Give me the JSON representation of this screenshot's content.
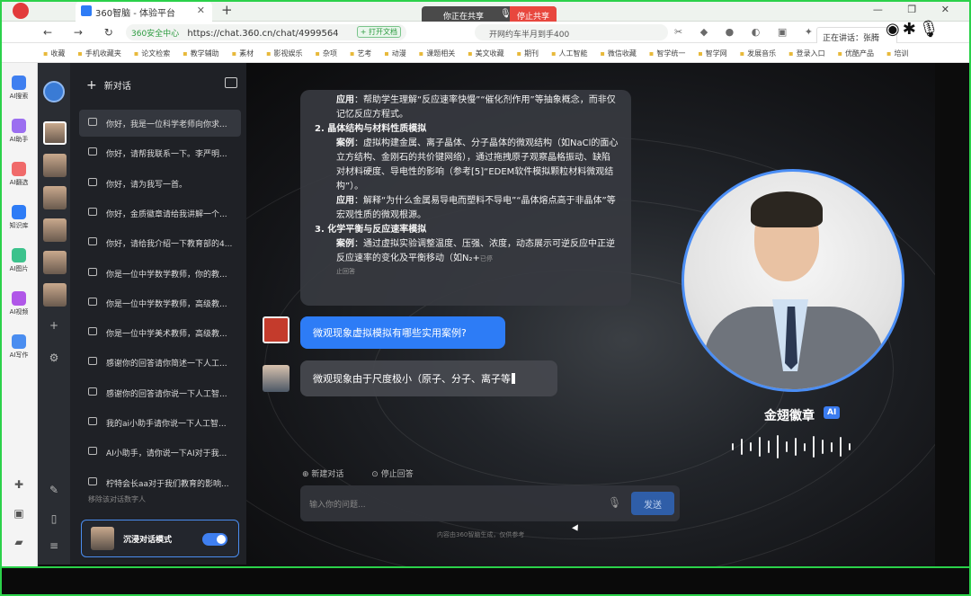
{
  "browser": {
    "tab_title": "360智脑 - 体验平台",
    "share_text": "你正在共享",
    "stop_share": "停止共享",
    "url_secure": "360安全中心",
    "url": "https://chat.360.cn/chat/4999564",
    "open_doc": "+ 打开文档",
    "search": "开网约车半月到手400",
    "speaking": "正在讲话：张腾",
    "bookmarks": [
      "收藏",
      "手机收藏夹",
      "论文检索",
      "教学辅助",
      "素材",
      "影视娱乐",
      "杂项",
      "艺考",
      "动漫",
      "课题相关",
      "美文收藏",
      "期刊",
      "人工智能",
      "微信收藏",
      "智学统一",
      "智学网",
      "发展音乐",
      "登录入口",
      "优酷产品",
      "培训"
    ]
  },
  "rail": {
    "items": [
      "AI搜索",
      "AI助手",
      "AI翻选",
      "知识库",
      "AI图片",
      "AI视频",
      "AI写作"
    ]
  },
  "sidebar": {
    "new_chat": "新对话",
    "conversations": [
      "你好，我是一位科学老师向你求...",
      "你好，请帮我联系一下。李严明...",
      "你好，请为我写一首。",
      "你好，金质徽章请给我讲解一个...",
      "你好，请给我介绍一下教育部的4...",
      "你是一位中学数学教师，你的教...",
      "你是一位中学数学教师，高级教...",
      "你是一位中学美术教师，高级教...",
      "感谢你的回答请你简述一下人工...",
      "感谢你的回答请你说一下人工智...",
      "我的ai小助手请你说一下人工智...",
      "AI小助手，请你说一下AI对于我...",
      "柠特会长aa对于我们教育的影响..."
    ],
    "remove_twin": "移除该对话数字人",
    "immersive_label": "沉浸对话模式"
  },
  "chat": {
    "answer": {
      "line1_label": "应用",
      "line1": "：帮助学生理解“反应速率快慢”“催化剂作用”等抽象概念，而非仅记忆反应方程式。",
      "h2": "2. 晶体结构与材料性质模拟",
      "c2_label": "案例",
      "c2": "：虚拟构建金属、离子晶体、分子晶体的微观结构（如NaCl的面心立方结构、金刚石的共价键网络），通过拖拽原子观察晶格振动、缺陷对材料硬度、导电性的影响（参考[5]“EDEM软件模拟颗粒材料微观结构”）。",
      "a2_label": "应用",
      "a2": "：解释“为什么金属易导电而塑料不导电”“晶体熔点高于非晶体”等宏观性质的微观根源。",
      "h3": "3. 化学平衡与反应速率模拟",
      "c3_label": "案例",
      "c3": "：通过虚拟实验调整温度、压强、浓度，动态展示可逆反应中正逆反应速率的变化及平衡移动（如N₂+",
      "cutoff": "已停",
      "stopped": "止回答"
    },
    "question": "微观现象虚拟模拟有哪些实用案例?",
    "streaming": "微观现象由于尺度极小（原子、分子、离子等",
    "new_chat_action": "新建对话",
    "stop_action": "停止回答",
    "input_placeholder": "输入你的问题...",
    "send": "发送",
    "disclaimer": "内容由360智脑生成，仅供参考"
  },
  "avatar": {
    "name": "金翅徽章",
    "badge": "AI"
  }
}
